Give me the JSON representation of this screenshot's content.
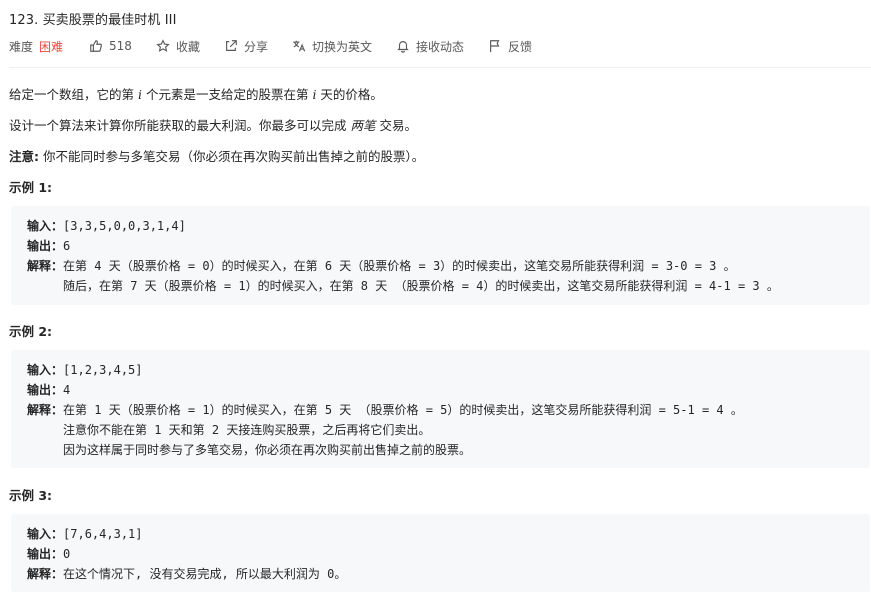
{
  "problem": {
    "title": "123. 买卖股票的最佳时机 III",
    "difficulty_label": "难度",
    "difficulty": "困难",
    "likes": "518",
    "collect": "收藏",
    "share": "分享",
    "switch_lang": "切换为英文",
    "follow": "接收动态",
    "feedback": "反馈"
  },
  "description": {
    "p1_a": "给定一个数组，它的第 ",
    "p1_i": "i",
    "p1_b": " 个元素是一支给定的股票在第 ",
    "p1_i2": "i",
    "p1_c": " 天的价格。",
    "p2_a": "设计一个算法来计算你所能获取的最大利润。你最多可以完成 ",
    "p2_em": "两笔",
    "p2_b": " 交易。",
    "note_label": "注意:",
    "note_text": " 你不能同时参与多笔交易（你必须在再次购买前出售掉之前的股票）。"
  },
  "examples": [
    {
      "title": "示例 1:",
      "input_label": "输入：",
      "input": "[3,3,5,0,0,3,1,4]",
      "output_label": "输出：",
      "output": "6",
      "explain_label": "解释：",
      "lines": [
        "在第 4 天（股票价格 = 0）的时候买入，在第 6 天（股票价格 = 3）的时候卖出，这笔交易所能获得利润 = 3-0 = 3 。",
        "随后，在第 7 天（股票价格 = 1）的时候买入，在第 8 天 （股票价格 = 4）的时候卖出，这笔交易所能获得利润 = 4-1 = 3 。"
      ]
    },
    {
      "title": "示例 2:",
      "input_label": "输入：",
      "input": "[1,2,3,4,5]",
      "output_label": "输出：",
      "output": "4",
      "explain_label": "解释：",
      "lines": [
        "在第 1 天（股票价格 = 1）的时候买入，在第 5 天 （股票价格 = 5）的时候卖出，这笔交易所能获得利润 = 5-1 = 4 。",
        "注意你不能在第 1 天和第 2 天接连购买股票，之后再将它们卖出。",
        "因为这样属于同时参与了多笔交易，你必须在再次购买前出售掉之前的股票。"
      ]
    },
    {
      "title": "示例 3:",
      "input_label": "输入：",
      "input": "[7,6,4,3,1]",
      "output_label": "输出：",
      "output": "0",
      "explain_label": "解释：",
      "lines": [
        "在这个情况下, 没有交易完成, 所以最大利润为 0。"
      ]
    }
  ]
}
